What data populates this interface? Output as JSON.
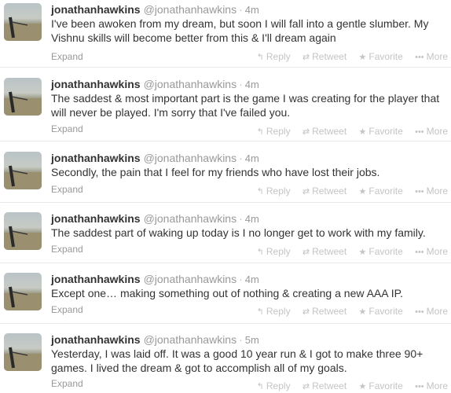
{
  "tweets": [
    {
      "fullname": "jonathanhawkins",
      "username": "@jonathanhawkins",
      "time": "4m",
      "text": "I've been awoken from my dream, but soon I will fall into a gentle slumber. My Vishnu skills will become better from this & I'll dream again",
      "expand": "Expand"
    },
    {
      "fullname": "jonathanhawkins",
      "username": "@jonathanhawkins",
      "time": "4m",
      "text": "The saddest & most important part is the game I was creating for the player that will never be played.  I'm sorry that I've failed you.",
      "expand": "Expand"
    },
    {
      "fullname": "jonathanhawkins",
      "username": "@jonathanhawkins",
      "time": "4m",
      "text": "Secondly, the pain that I feel for my friends who have lost their jobs.",
      "expand": "Expand"
    },
    {
      "fullname": "jonathanhawkins",
      "username": "@jonathanhawkins",
      "time": "4m",
      "text": "The saddest part of waking up today is I no longer get to work with my family.",
      "expand": "Expand"
    },
    {
      "fullname": "jonathanhawkins",
      "username": "@jonathanhawkins",
      "time": "4m",
      "text": "Except one… making something out of nothing & creating a new AAA IP.",
      "expand": "Expand"
    },
    {
      "fullname": "jonathanhawkins",
      "username": "@jonathanhawkins",
      "time": "5m",
      "text": "Yesterday, I was laid off. It was a good 10 year run & I got to make three 90+ games. I lived the dream & got to accomplish all of my goals.",
      "expand": "Expand"
    }
  ],
  "actions": {
    "reply": "Reply",
    "retweet": "Retweet",
    "favorite": "Favorite",
    "more": "More"
  },
  "icons": {
    "reply": "reply-arrow-icon",
    "retweet": "retweet-icon",
    "favorite": "star-icon",
    "more": "ellipsis-icon"
  },
  "colors": {
    "name": "#333333",
    "meta": "#999999",
    "action": "#c4c4c4",
    "divider": "#e8e8e8"
  }
}
